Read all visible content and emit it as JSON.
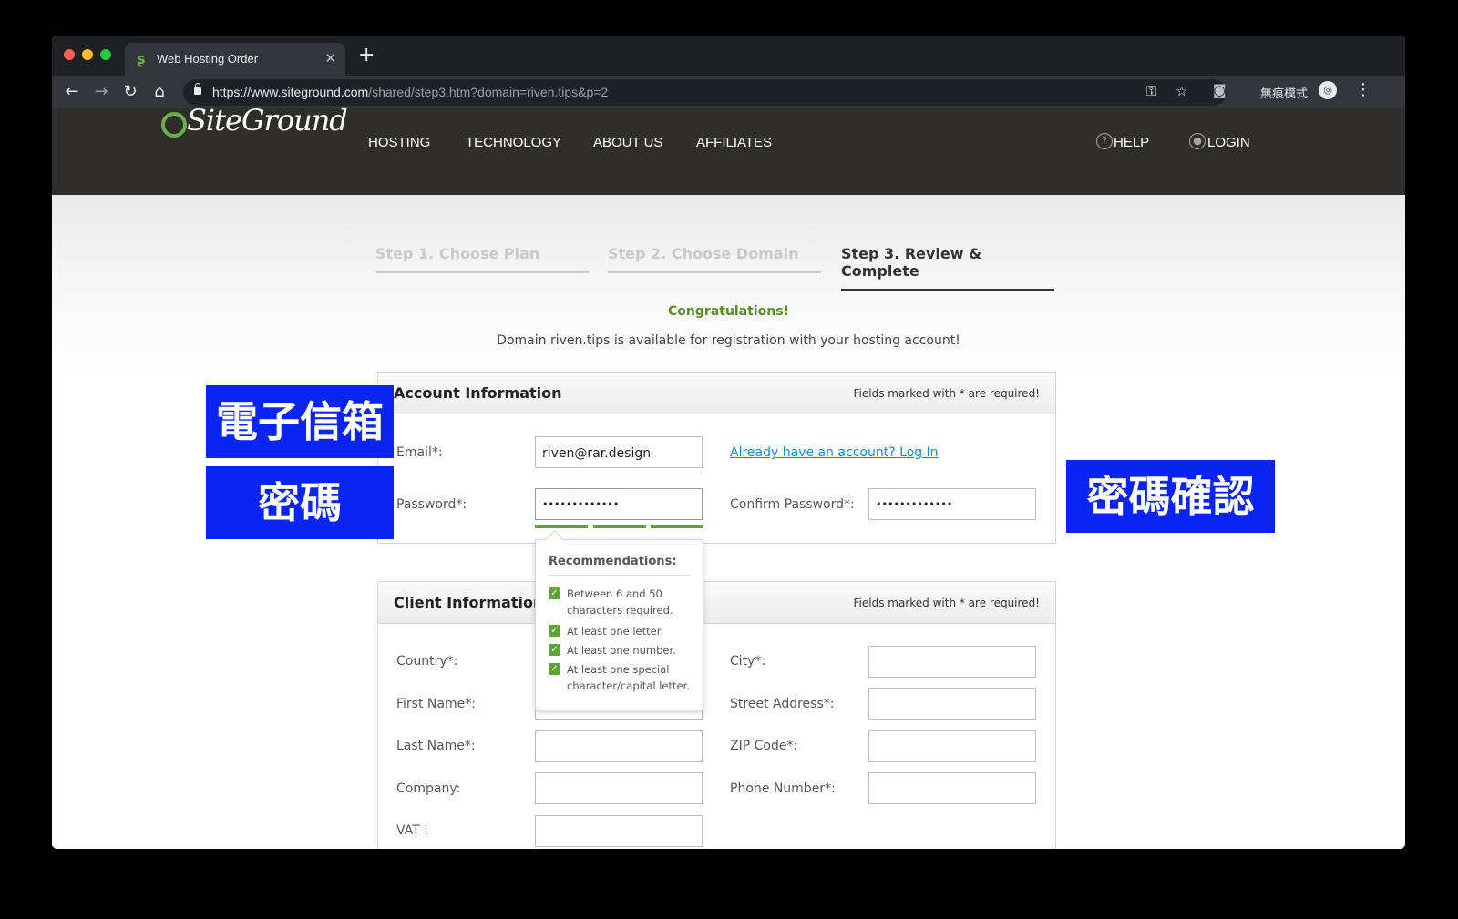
{
  "browser": {
    "tab_title": "Web Hosting Order",
    "url_host": "https://www.siteground.com",
    "url_path": "/shared/step3.htm?domain=riven.tips&p=2",
    "incognito_label": "無痕模式"
  },
  "site": {
    "logo_text": "SiteGround",
    "nav": [
      "HOSTING",
      "TECHNOLOGY",
      "ABOUT US",
      "AFFILIATES"
    ],
    "help": "HELP",
    "login": "LOGIN"
  },
  "steps": [
    {
      "label": "Step 1. Choose Plan",
      "state": "done"
    },
    {
      "label": "Step 2. Choose Domain",
      "state": "done"
    },
    {
      "label": "Step 3. Review & Complete",
      "state": "active"
    }
  ],
  "congrats": "Congratulations!",
  "availability": "Domain riven.tips is available for registration with your hosting account!",
  "account": {
    "title": "Account Information",
    "required_note": "Fields marked with * are required!",
    "email_label": "Email*:",
    "email_value": "riven@rar.design",
    "login_link": "Already have an account? Log In",
    "password_label": "Password*:",
    "password_value": "•••••••••••••",
    "confirm_label": "Confirm Password*:",
    "confirm_value": "•••••••••••••",
    "strength_segments": 3
  },
  "recommendations": {
    "title": "Recommendations:",
    "items": [
      "Between 6 and 50 characters required.",
      "At least one letter.",
      "At least one number.",
      "At least one special character/capital letter."
    ]
  },
  "client": {
    "title": "Client Information",
    "required_note": "Fields marked with * are required!",
    "left_labels": [
      "Country*:",
      "First Name*:",
      "Last Name*:",
      "Company:",
      "VAT :"
    ],
    "right_labels": [
      "City*:",
      "Street Address*:",
      "ZIP Code*:",
      "Phone Number*:"
    ]
  },
  "annotations": {
    "email": "電子信箱",
    "password": "密碼",
    "confirm": "密碼確認",
    "color": "#0a24f2"
  }
}
